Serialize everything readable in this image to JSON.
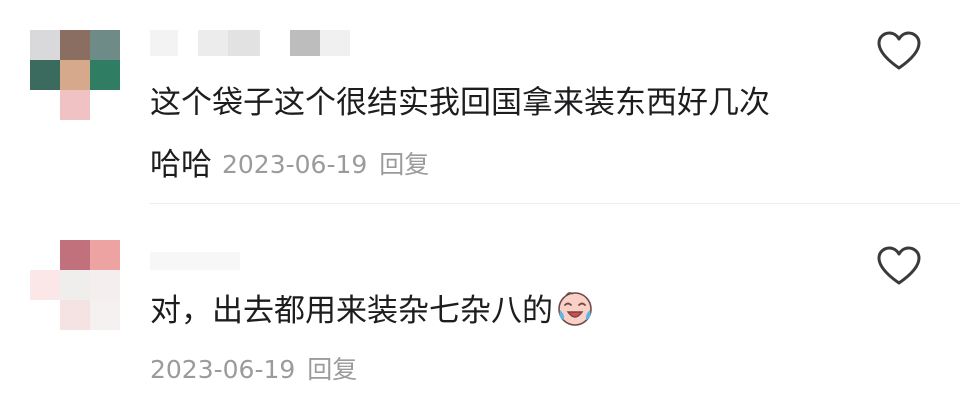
{
  "comments": [
    {
      "username": "",
      "text_line1": "这个袋子这个很结实我回国拿来装东西好几次",
      "text_line2": "哈哈",
      "date": "2023-06-19",
      "reply_label": "回复",
      "like_icon": "heart-outline-icon"
    },
    {
      "username": "",
      "text": "对，出去都用来装杂七杂八的",
      "emoji": "crying-laughing-emoji",
      "date": "2023-06-19",
      "reply_label": "回复",
      "like_icon": "heart-outline-icon"
    }
  ],
  "colors": {
    "text": "#1d1d1f",
    "meta": "#9b9b9b",
    "divider": "#ececec",
    "icon": "#3a3a3a"
  }
}
